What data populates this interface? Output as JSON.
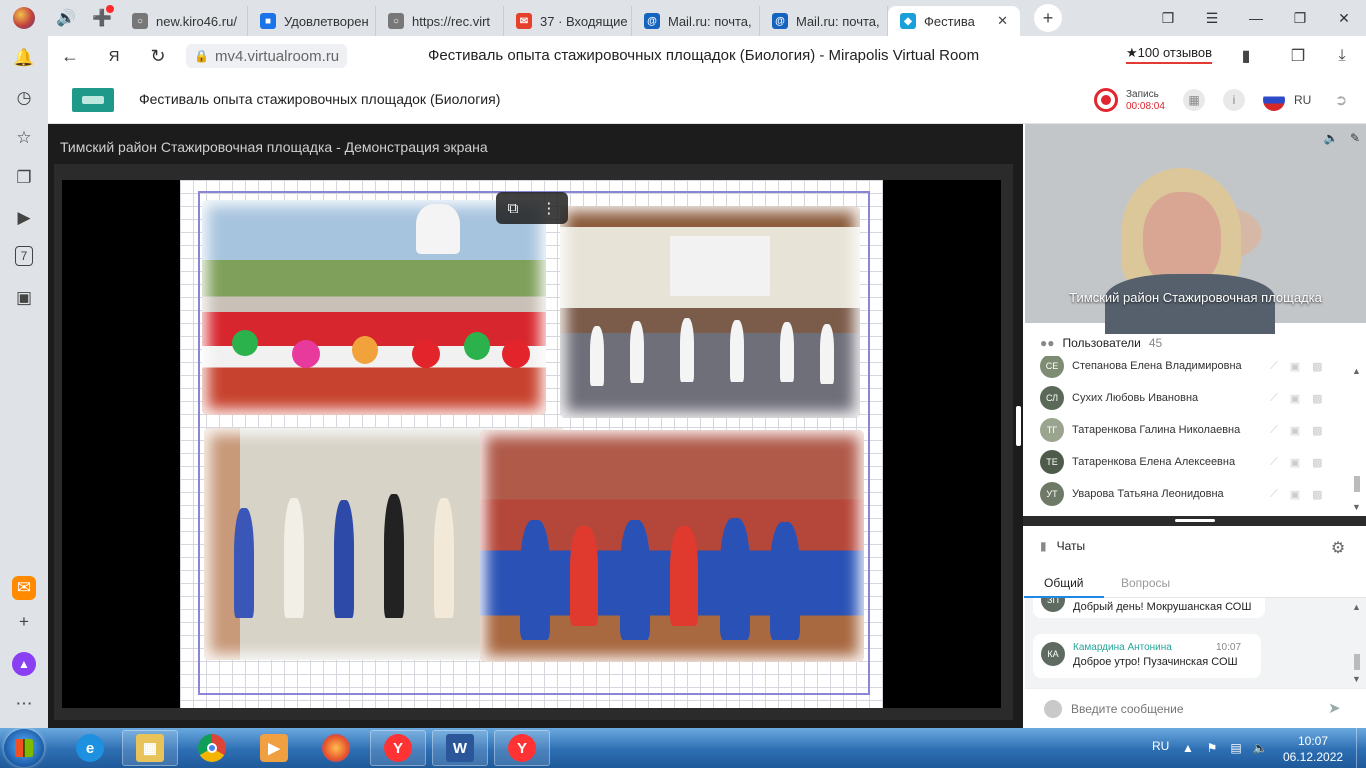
{
  "browser": {
    "tabs": [
      {
        "label": "new.kiro46.ru/",
        "fav_color": "#777777"
      },
      {
        "label": "Удовлетворен",
        "fav_color": "#1a73e8"
      },
      {
        "label": "https://rec.virt",
        "fav_color": "#777777"
      },
      {
        "label": "37 · Входящие",
        "fav_color": "#e5402b"
      },
      {
        "label": "Mail.ru: почта,",
        "fav_color": "#1565c0"
      },
      {
        "label": "Mail.ru: почта,",
        "fav_color": "#1565c0"
      },
      {
        "label": "Фестива",
        "fav_color": "#1aa0d9",
        "active": true
      }
    ],
    "address": {
      "domain": "mv4.virtualroom.ru",
      "page_title": "Фестиваль опыта стажировочных площадок (Биология) - Mirapolis Virtual Room"
    },
    "reviews_label": "★100 отзывов",
    "sidebar_badge": "7"
  },
  "app": {
    "title": "Фестиваль опыта стажировочных площадок (Биология)",
    "record_label": "Запись",
    "record_time": "00:08:04",
    "language": "RU",
    "brand_color": "#1f9a8a",
    "record_color": "#e0262f"
  },
  "stage": {
    "title": "Тимский район Стажировочная площадка - Демонстрация экрана"
  },
  "video": {
    "caption": "Тимский район Стажировочная площадка"
  },
  "users": {
    "label": "Пользователи",
    "count": "45",
    "items": [
      {
        "initials": "СЕ",
        "name": "Степанова Елена Владимировна",
        "color": "#7d8c73"
      },
      {
        "initials": "СЛ",
        "name": "Сухих Любовь Ивановна",
        "color": "#5b6a58"
      },
      {
        "initials": "ТГ",
        "name": "Татаренкова Галина Николаевна",
        "color": "#9aa48e"
      },
      {
        "initials": "ТЕ",
        "name": "Татаренкова Елена Алексеевна",
        "color": "#4e5b4b"
      },
      {
        "initials": "УТ",
        "name": "Уварова Татьяна Леонидовна",
        "color": "#6e7a67"
      }
    ]
  },
  "chats": {
    "label": "Чаты",
    "tabs": [
      "Общий",
      "Вопросы"
    ],
    "messages": [
      {
        "initials": "ЗП",
        "text": "Добрый день! Мокрушанская СОШ"
      },
      {
        "initials": "КА",
        "author": "Камардина Антонина",
        "time": "10:07",
        "text": "Доброе утро! Пузачинская СОШ"
      }
    ],
    "input_placeholder": "Введите сообщение"
  },
  "taskbar": {
    "language": "RU",
    "time": "10:07",
    "date": "06.12.2022"
  }
}
